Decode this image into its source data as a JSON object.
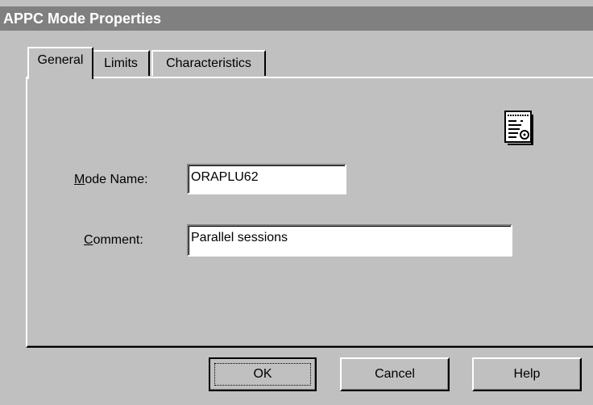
{
  "window": {
    "title": "APPC Mode Properties"
  },
  "tabs": [
    {
      "label": "General",
      "active": true
    },
    {
      "label": "Limits",
      "active": false
    },
    {
      "label": "Characteristics",
      "active": false
    }
  ],
  "general": {
    "mode_name_label_mnemonic": "M",
    "mode_name_label_rest": "ode Name:",
    "mode_name_value": "ORAPLU62",
    "comment_label_mnemonic": "C",
    "comment_label_rest": "omment:",
    "comment_value": "Parallel sessions",
    "icon": "properties-document-icon"
  },
  "buttons": {
    "ok": "OK",
    "cancel": "Cancel",
    "help": "Help"
  },
  "colors": {
    "face": "#c0c0c0",
    "title_bar": "#808080",
    "title_text": "#ffffff",
    "field_bg": "#ffffff"
  }
}
